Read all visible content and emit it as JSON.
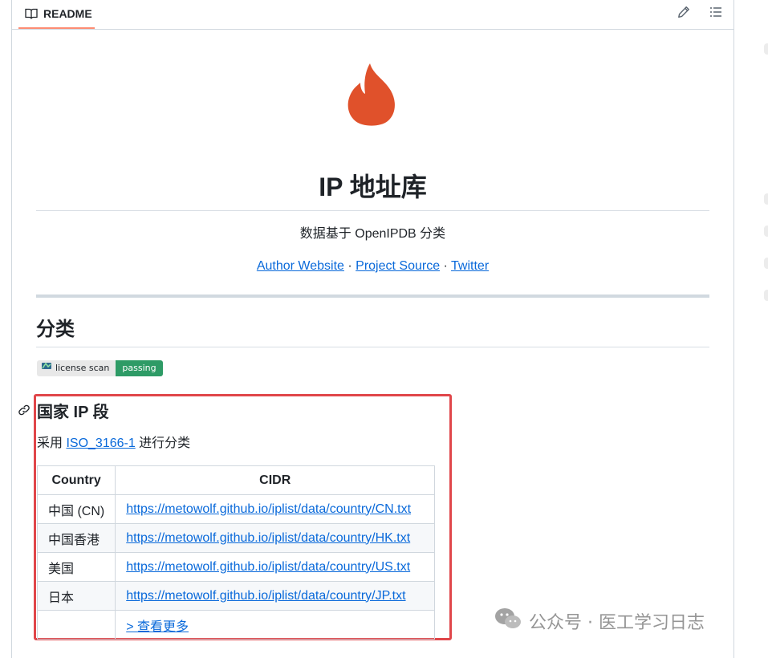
{
  "header": {
    "tab_label": "README"
  },
  "repo": {
    "title": "IP 地址库",
    "subtitle": "数据基于 OpenIPDB 分类",
    "links": [
      "Author Website",
      "Project Source",
      "Twitter"
    ],
    "link_separator": " · "
  },
  "section_classify": {
    "heading": "分类",
    "badge": {
      "label": "license scan",
      "status": "passing",
      "status_color": "#2e9b66"
    }
  },
  "section_country": {
    "heading": "国家 IP 段",
    "intro_prefix": "采用 ",
    "intro_link": "ISO_3166-1",
    "intro_suffix": " 进行分类",
    "table": {
      "headers": [
        "Country",
        "CIDR"
      ],
      "rows": [
        {
          "country": "中国 (CN)",
          "cidr": "https://metowolf.github.io/iplist/data/country/CN.txt"
        },
        {
          "country": "中国香港",
          "cidr": "https://metowolf.github.io/iplist/data/country/HK.txt"
        },
        {
          "country": "美国",
          "cidr": "https://metowolf.github.io/iplist/data/country/US.txt"
        },
        {
          "country": "日本",
          "cidr": "https://metowolf.github.io/iplist/data/country/JP.txt"
        },
        {
          "country": "",
          "cidr": "> 查看更多"
        }
      ]
    }
  },
  "watermark": {
    "text": "公众号 · 医工学习日志"
  },
  "colors": {
    "accent_tab": "#fd8c73",
    "link": "#0969da",
    "logo": "#e0512b",
    "highlight_box": "#e0464a"
  }
}
